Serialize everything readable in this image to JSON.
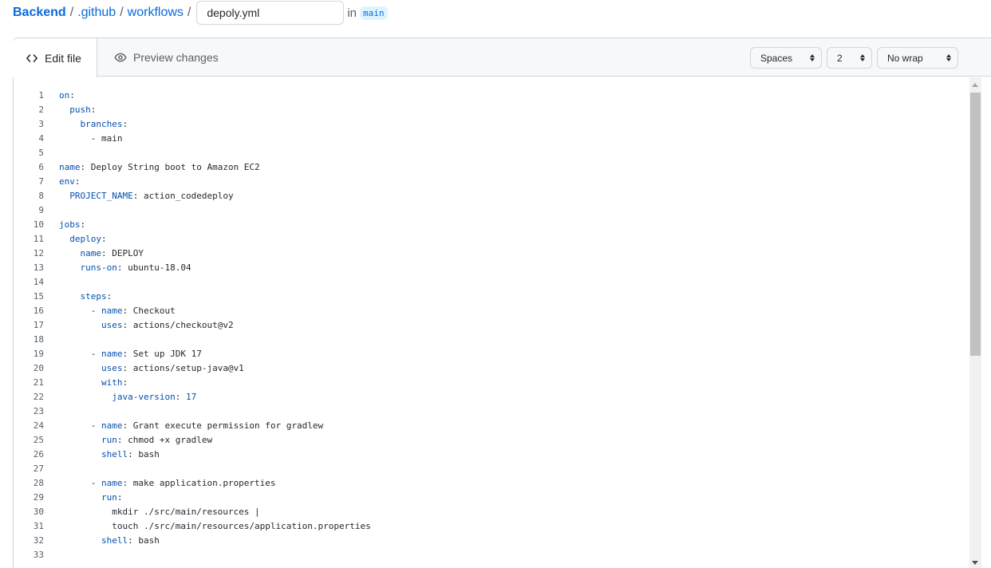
{
  "breadcrumb": {
    "repo": "Backend",
    "sep1": "/",
    "folder1": ".github",
    "sep2": "/",
    "folder2": "workflows",
    "sep3": "/",
    "filename_value": "depoly.yml",
    "in_text": "in",
    "branch": "main"
  },
  "tabs": {
    "edit_label": "Edit file",
    "preview_label": "Preview changes"
  },
  "options": {
    "indent_mode": "Spaces",
    "indent_size": "2",
    "wrap_mode": "No wrap"
  },
  "code_lines": [
    {
      "num": "1",
      "indent": "",
      "key": "on",
      "sep": ":",
      "value": "",
      "num_value": false
    },
    {
      "num": "2",
      "indent": "  ",
      "key": "push",
      "sep": ":",
      "value": "",
      "num_value": false
    },
    {
      "num": "3",
      "indent": "    ",
      "key": "branches",
      "sep": ":",
      "value": "",
      "num_value": false
    },
    {
      "num": "4",
      "indent": "      - ",
      "key": "",
      "sep": "",
      "value": "main",
      "num_value": false
    },
    {
      "num": "5",
      "indent": "",
      "key": "",
      "sep": "",
      "value": "",
      "num_value": false
    },
    {
      "num": "6",
      "indent": "",
      "key": "name",
      "sep": ": ",
      "value": "Deploy String boot to Amazon EC2",
      "num_value": false
    },
    {
      "num": "7",
      "indent": "",
      "key": "env",
      "sep": ":",
      "value": "",
      "num_value": false
    },
    {
      "num": "8",
      "indent": "  ",
      "key": "PROJECT_NAME",
      "sep": ": ",
      "value": "action_codedeploy",
      "num_value": false
    },
    {
      "num": "9",
      "indent": "",
      "key": "",
      "sep": "",
      "value": "",
      "num_value": false
    },
    {
      "num": "10",
      "indent": "",
      "key": "jobs",
      "sep": ":",
      "value": "",
      "num_value": false
    },
    {
      "num": "11",
      "indent": "  ",
      "key": "deploy",
      "sep": ":",
      "value": "",
      "num_value": false
    },
    {
      "num": "12",
      "indent": "    ",
      "key": "name",
      "sep": ": ",
      "value": "DEPLOY",
      "num_value": false
    },
    {
      "num": "13",
      "indent": "    ",
      "key": "runs-on",
      "sep": ": ",
      "value": "ubuntu-18.04",
      "num_value": false
    },
    {
      "num": "14",
      "indent": "",
      "key": "",
      "sep": "",
      "value": "",
      "num_value": false
    },
    {
      "num": "15",
      "indent": "    ",
      "key": "steps",
      "sep": ":",
      "value": "",
      "num_value": false
    },
    {
      "num": "16",
      "indent": "      - ",
      "key": "name",
      "sep": ": ",
      "value": "Checkout",
      "num_value": false
    },
    {
      "num": "17",
      "indent": "        ",
      "key": "uses",
      "sep": ": ",
      "value": "actions/checkout@v2",
      "num_value": false
    },
    {
      "num": "18",
      "indent": "",
      "key": "",
      "sep": "",
      "value": "",
      "num_value": false
    },
    {
      "num": "19",
      "indent": "      - ",
      "key": "name",
      "sep": ": ",
      "value": "Set up JDK 17",
      "num_value": false
    },
    {
      "num": "20",
      "indent": "        ",
      "key": "uses",
      "sep": ": ",
      "value": "actions/setup-java@v1",
      "num_value": false
    },
    {
      "num": "21",
      "indent": "        ",
      "key": "with",
      "sep": ":",
      "value": "",
      "num_value": false
    },
    {
      "num": "22",
      "indent": "          ",
      "key": "java-version",
      "sep": ": ",
      "value": "17",
      "num_value": true
    },
    {
      "num": "23",
      "indent": "",
      "key": "",
      "sep": "",
      "value": "",
      "num_value": false
    },
    {
      "num": "24",
      "indent": "      - ",
      "key": "name",
      "sep": ": ",
      "value": "Grant execute permission for gradlew",
      "num_value": false
    },
    {
      "num": "25",
      "indent": "        ",
      "key": "run",
      "sep": ": ",
      "value": "chmod +x gradlew",
      "num_value": false
    },
    {
      "num": "26",
      "indent": "        ",
      "key": "shell",
      "sep": ": ",
      "value": "bash",
      "num_value": false
    },
    {
      "num": "27",
      "indent": "",
      "key": "",
      "sep": "",
      "value": "",
      "num_value": false
    },
    {
      "num": "28",
      "indent": "      - ",
      "key": "name",
      "sep": ": ",
      "value": "make application.properties",
      "num_value": false
    },
    {
      "num": "29",
      "indent": "        ",
      "key": "run",
      "sep": ":",
      "value": "",
      "num_value": false
    },
    {
      "num": "30",
      "indent": "          ",
      "key": "",
      "sep": "",
      "value": "mkdir ./src/main/resources |",
      "num_value": false
    },
    {
      "num": "31",
      "indent": "          ",
      "key": "",
      "sep": "",
      "value": "touch ./src/main/resources/application.properties",
      "num_value": false
    },
    {
      "num": "32",
      "indent": "        ",
      "key": "shell",
      "sep": ": ",
      "value": "bash",
      "num_value": false
    },
    {
      "num": "33",
      "indent": "",
      "key": "",
      "sep": "",
      "value": "",
      "num_value": false
    }
  ]
}
